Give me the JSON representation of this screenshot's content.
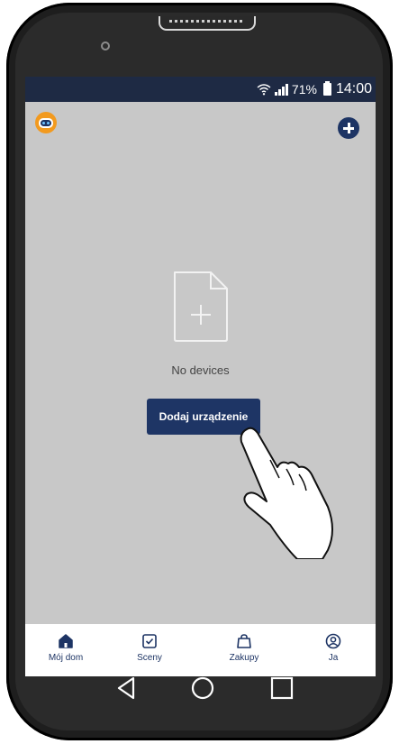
{
  "status_bar": {
    "battery_percent": "71%",
    "time": "14:00"
  },
  "header": {
    "avatar_icon": "robot-avatar-icon",
    "add_icon": "plus-circle-icon"
  },
  "main": {
    "empty_icon": "add-document-icon",
    "empty_text": "No devices",
    "add_device_label": "Dodaj urządzenie"
  },
  "bottom_nav": {
    "items": [
      {
        "label": "Mój dom",
        "icon": "home-icon"
      },
      {
        "label": "Sceny",
        "icon": "checkbox-icon"
      },
      {
        "label": "Zakupy",
        "icon": "shopping-bag-icon"
      },
      {
        "label": "Ja",
        "icon": "user-circle-icon"
      }
    ]
  },
  "colors": {
    "accent": "#1e3565",
    "status_bar": "#1e2a44",
    "screen_bg": "#c8c8c8"
  }
}
